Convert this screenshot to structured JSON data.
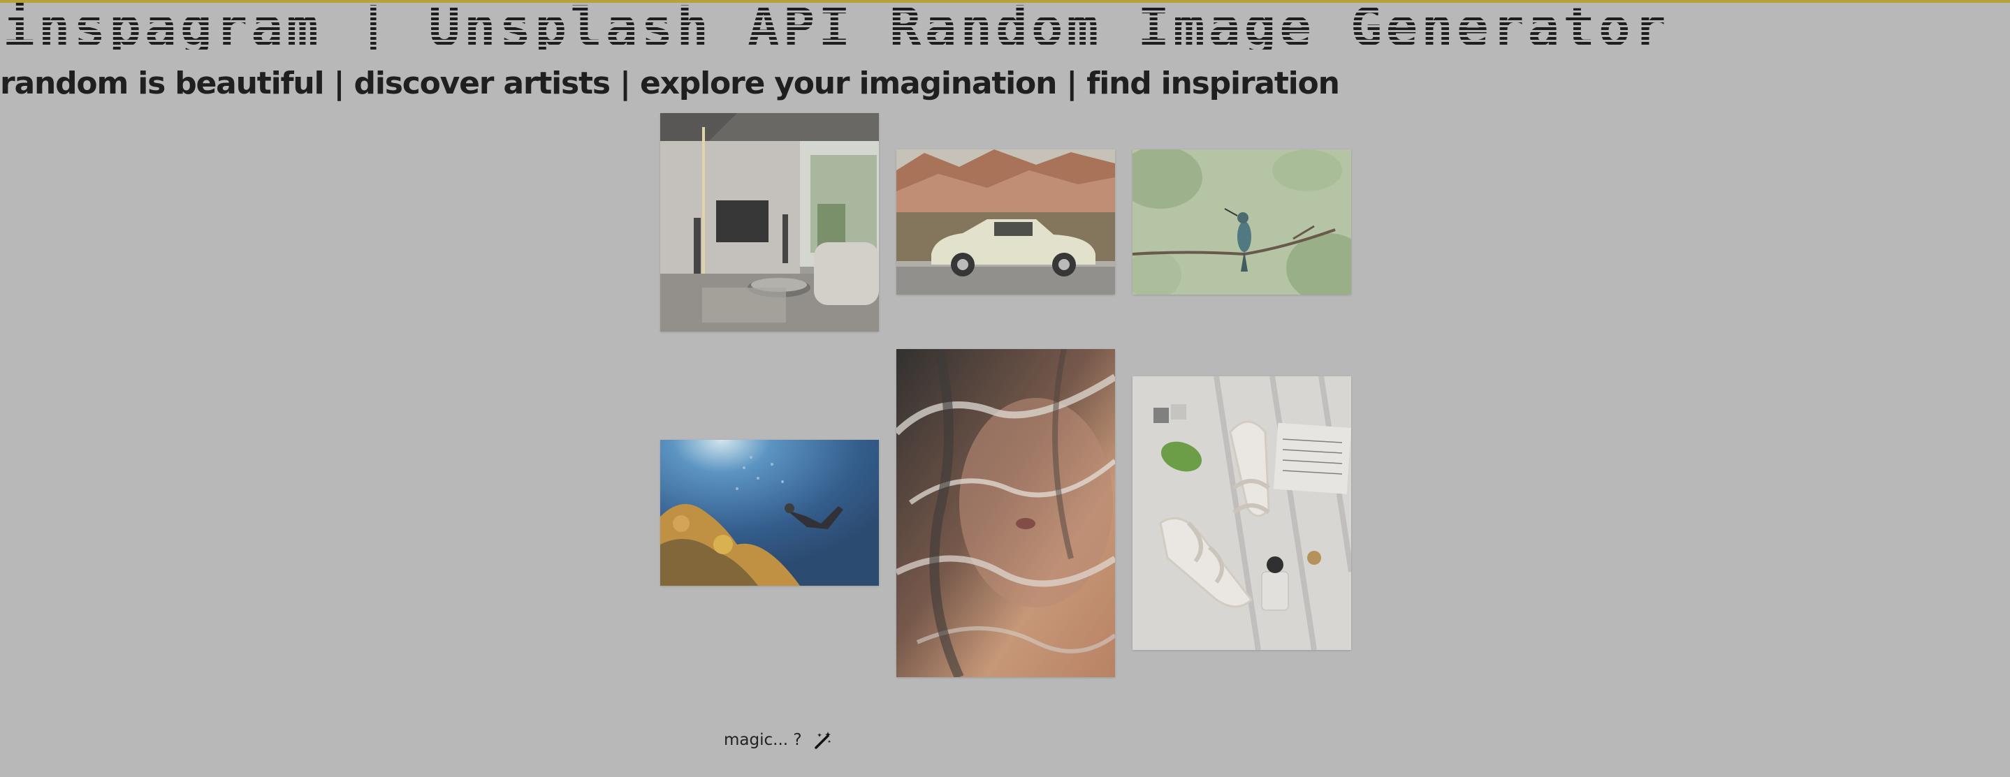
{
  "header": {
    "title": "inspagram | Unsplash API Random Image Generator",
    "tagline": "random is beautiful | discover artists | explore your imagination | find inspiration"
  },
  "gallery": {
    "images": [
      {
        "subject": "modern living room interior"
      },
      {
        "subject": "vintage white car in desert canyon"
      },
      {
        "subject": "hummingbird on branch"
      },
      {
        "subject": "scuba diver over coral reef"
      },
      {
        "subject": "face behind wet glass"
      },
      {
        "subject": "braided sandals flat lay"
      }
    ]
  },
  "footer": {
    "label": "magic... ?",
    "icon": "magic-wand-icon"
  },
  "colors": {
    "background": "#b8b8b8",
    "accent_border": "#b8a03a",
    "text": "#1f1f1f"
  }
}
